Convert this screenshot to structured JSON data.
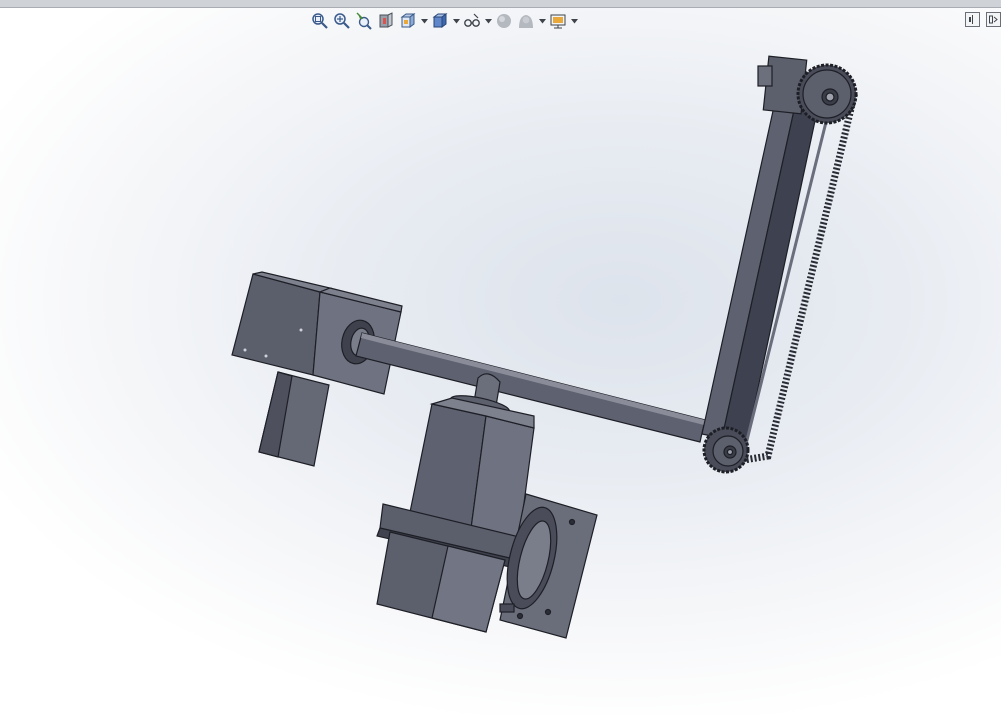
{
  "toolbar": {
    "items": [
      {
        "name": "zoom-to-fit",
        "icon": "zoom-to-fit-icon",
        "has_dropdown": false
      },
      {
        "name": "zoom-to-area",
        "icon": "zoom-to-area-icon",
        "has_dropdown": false
      },
      {
        "name": "previous-view",
        "icon": "previous-view-icon",
        "has_dropdown": false
      },
      {
        "name": "section-view",
        "icon": "section-view-icon",
        "has_dropdown": false
      },
      {
        "name": "view-orientation",
        "icon": "view-orientation-icon",
        "has_dropdown": true
      },
      {
        "name": "display-style",
        "icon": "display-style-icon",
        "has_dropdown": true
      },
      {
        "name": "hide-show-items",
        "icon": "hide-show-icon",
        "has_dropdown": true
      },
      {
        "name": "edit-appearance",
        "icon": "edit-appearance-icon",
        "has_dropdown": false
      },
      {
        "name": "apply-scene",
        "icon": "apply-scene-icon",
        "has_dropdown": true
      },
      {
        "name": "view-settings",
        "icon": "view-settings-icon",
        "has_dropdown": true
      }
    ]
  },
  "window_controls": [
    "split-view-icon",
    "expand-panel-icon"
  ],
  "colors": {
    "part_body": "#585b68",
    "part_face_light": "#6f7280",
    "part_face_dark": "#464955",
    "edge": "#1e1f26",
    "background_center": "#dde3ec",
    "background_edge": "#ffffff"
  }
}
